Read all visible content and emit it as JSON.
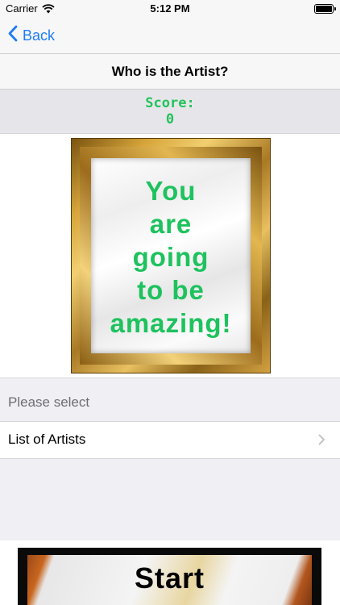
{
  "status_bar": {
    "carrier": "Carrier",
    "time": "5:12 PM"
  },
  "nav": {
    "back_label": "Back"
  },
  "title": "Who is the Artist?",
  "score": {
    "label": "Score:",
    "value": "0"
  },
  "painting": {
    "lines": [
      "You",
      "are",
      "going",
      "to be",
      "amazing!"
    ],
    "text_color": "#1ec25e"
  },
  "section_header": "Please select",
  "list": {
    "label": "List of Artists"
  },
  "start_button": {
    "label": "Start"
  },
  "colors": {
    "accent": "#1e7cf5",
    "score_green": "#22c25a"
  }
}
